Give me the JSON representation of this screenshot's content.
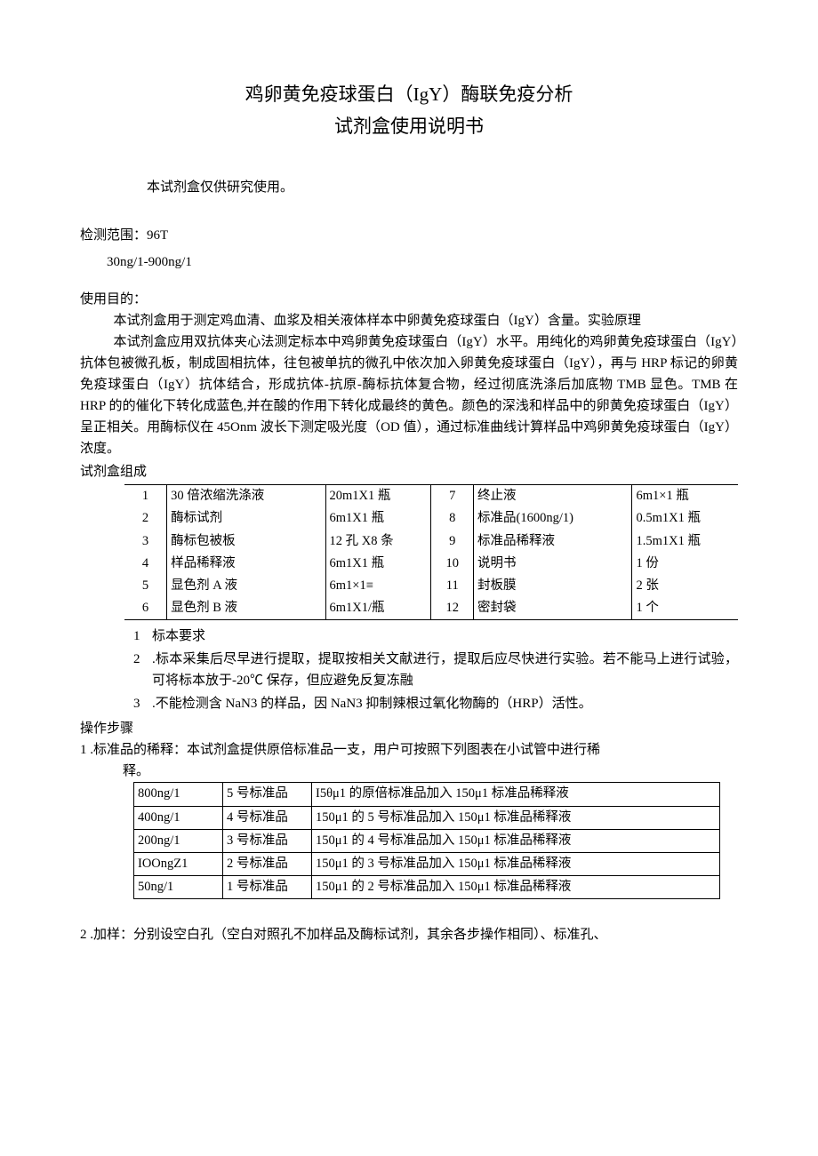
{
  "title": {
    "line1": "鸡卵黄免疫球蛋白（IgY）酶联免疫分析",
    "line2": "试剂盒使用说明书"
  },
  "intro": "本试剂盒仅供研究使用。",
  "range_label": "检测范围：96T",
  "range_value": "30ng/1-900ng/1",
  "purpose_label": "使用目的：",
  "purpose_para1": "本试剂盒用于测定鸡血清、血浆及相关液体样本中卵黄免疫球蛋白（IgY）含量。实验原理",
  "purpose_para2": "本试剂盒应用双抗体夹心法测定标本中鸡卵黄免疫球蛋白（IgY）水平。用纯化的鸡卵黄免疫球蛋白（IgY）抗体包被微孔板，制成固相抗体，往包被单抗的微孔中依次加入卵黄免疫球蛋白（IgY），再与 HRP 标记的卵黄免疫球蛋白（IgY）抗体结合，形成抗体-抗原-酶标抗体复合物，经过彻底洗涤后加底物 TMB 显色。TMB 在 HRP 的的催化下转化成蓝色,并在酸的作用下转化成最终的黄色。颜色的深浅和样品中的卵黄免疫球蛋白（IgY）呈正相关。用酶标仪在 45Onm 波长下测定吸光度（OD 值），通过标准曲线计算样品中鸡卵黄免疫球蛋白（IgY）浓度。",
  "components_label": "试剂盒组成",
  "components": [
    {
      "n1": "1",
      "name1": "30 倍浓缩洗涤液",
      "spec1": "20m1X1 瓶",
      "n2": "7",
      "name2": "终止液",
      "spec2": "6m1×1 瓶"
    },
    {
      "n1": "2",
      "name1": "酶标试剂",
      "spec1": "6m1X1 瓶",
      "n2": "8",
      "name2": "标准品(1600ng/1)",
      "spec2": "0.5m1X1 瓶"
    },
    {
      "n1": "3",
      "name1": "酶标包被板",
      "spec1": "12 孔 X8 条",
      "n2": "9",
      "name2": "标准品稀释液",
      "spec2": "1.5m1X1 瓶"
    },
    {
      "n1": "4",
      "name1": "样品稀释液",
      "spec1": "6m1X1 瓶",
      "n2": "10",
      "name2": "说明书",
      "spec2": "1 份"
    },
    {
      "n1": "5",
      "name1": "显色剂 A 液",
      "spec1": "6m1×1≡",
      "n2": "11",
      "name2": "封板膜",
      "spec2": "2 张"
    },
    {
      "n1": "6",
      "name1": "显色剂 B 液",
      "spec1": "6m1X1/瓶",
      "n2": "12",
      "name2": "密封袋",
      "spec2": "1 个"
    }
  ],
  "req": [
    {
      "marker": "1",
      "text": "标本要求"
    },
    {
      "marker": "2",
      "text": ".标本采集后尽早进行提取，提取按相关文献进行，提取后应尽快进行实验。若不能马上进行试验，可将标本放于-20℃ 保存，但应避免反复冻融"
    },
    {
      "marker": "3",
      "text": ".不能检测含 NaN3 的样品，因 NaN3 抑制辣根过氧化物酶的（HRP）活性。"
    }
  ],
  "steps_label": "操作步骤",
  "step1_line": "1 .标准品的稀释：本试剂盒提供原倍标准品一支，用户可按照下列图表在小试管中进行稀",
  "step1_sub": "释。",
  "dilution": [
    {
      "c1": "800ng/1",
      "c2": "5 号标准品",
      "c3": "I5θμ1 的原倍标准品加入 150μ1 标准品稀释液"
    },
    {
      "c1": "400ng/1",
      "c2": "4 号标准品",
      "c3": "150μ1 的 5 号标准品加入 150μ1 标准品稀释液"
    },
    {
      "c1": "200ng/1",
      "c2": "3 号标准品",
      "c3": "150μ1 的 4 号标准品加入 150μ1 标准品稀释液"
    },
    {
      "c1": "IOOngZ1",
      "c2": "2 号标准品",
      "c3": "150μ1 的 3 号标准品加入 150μ1 标准品稀释液"
    },
    {
      "c1": "50ng/1",
      "c2": "1 号标准品",
      "c3": "150μ1 的 2 号标准品加入 150μ1 标准品稀释液"
    }
  ],
  "step2": "2 .加样：分别设空白孔（空白对照孔不加样品及酶标试剂，其余各步操作相同）、标准孔、"
}
